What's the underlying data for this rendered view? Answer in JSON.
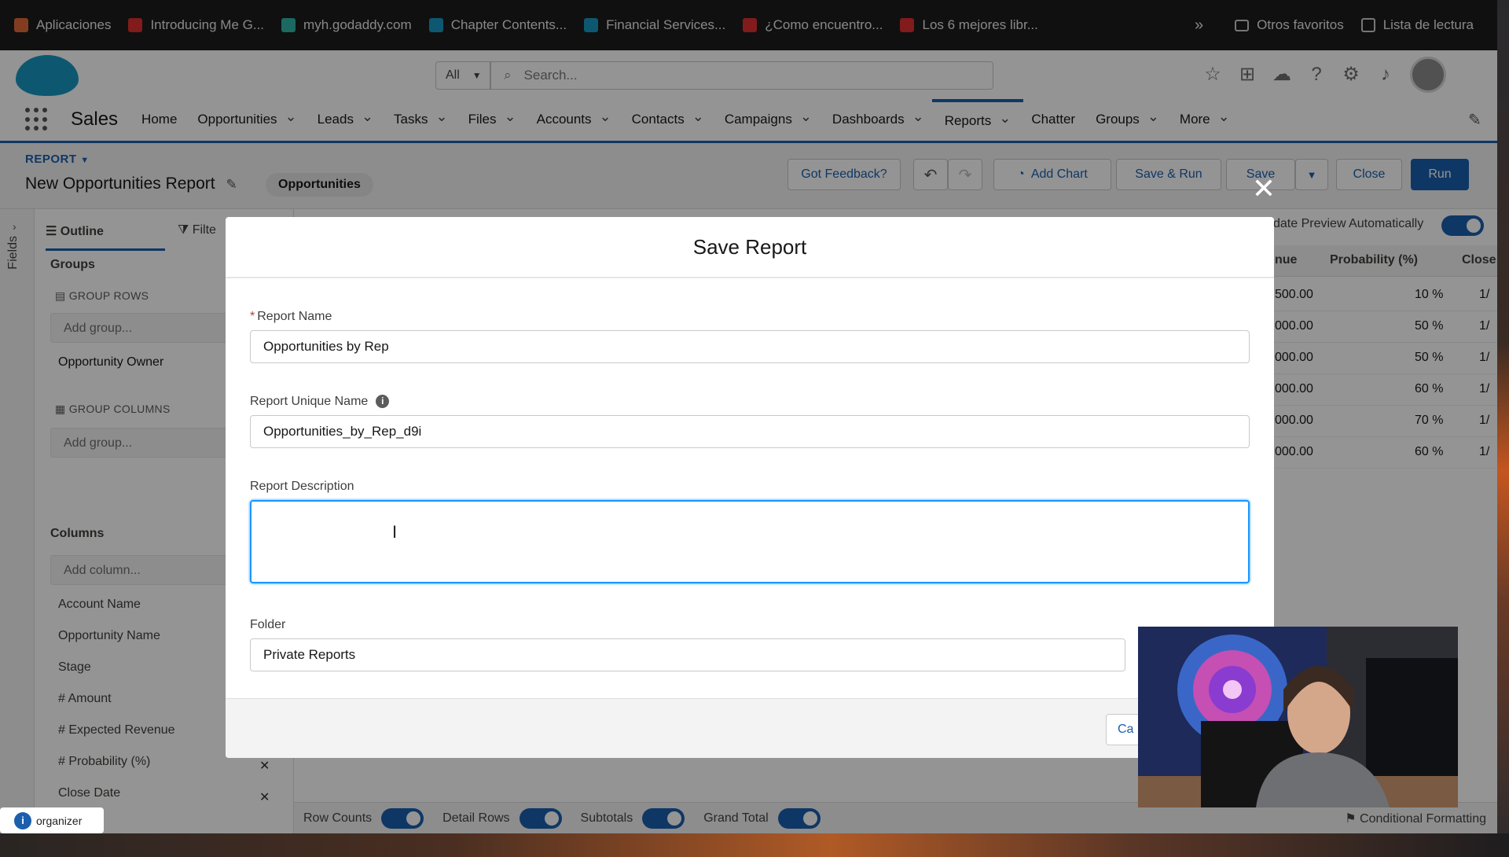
{
  "bookmarks": [
    {
      "label": "Aplicaciones",
      "color": "#e06a3a"
    },
    {
      "label": "Introducing Me G...",
      "color": "#e03030"
    },
    {
      "label": "myh.godaddy.com",
      "color": "#2fb5a5"
    },
    {
      "label": "Chapter Contents...",
      "color": "#1798c1"
    },
    {
      "label": "Financial Services...",
      "color": "#1798c1"
    },
    {
      "label": "¿Como encuentro...",
      "color": "#e03030"
    },
    {
      "label": "Los 6 mejores libr...",
      "color": "#e03030"
    }
  ],
  "bookmarks_overflow": "»",
  "bookmarks_right": [
    {
      "label": "Otros favoritos"
    },
    {
      "label": "Lista de lectura"
    }
  ],
  "search": {
    "scope": "All",
    "placeholder": "Search..."
  },
  "nav": {
    "app_name": "Sales",
    "items": [
      {
        "label": "Home",
        "chevron": false
      },
      {
        "label": "Opportunities",
        "chevron": true
      },
      {
        "label": "Leads",
        "chevron": true
      },
      {
        "label": "Tasks",
        "chevron": true
      },
      {
        "label": "Files",
        "chevron": true
      },
      {
        "label": "Accounts",
        "chevron": true
      },
      {
        "label": "Contacts",
        "chevron": true
      },
      {
        "label": "Campaigns",
        "chevron": true
      },
      {
        "label": "Dashboards",
        "chevron": true
      },
      {
        "label": "Reports",
        "chevron": true,
        "active": true
      },
      {
        "label": "Chatter",
        "chevron": false
      },
      {
        "label": "Groups",
        "chevron": true
      },
      {
        "label": "More",
        "chevron": true
      }
    ]
  },
  "report": {
    "type": "REPORT",
    "title": "New Opportunities Report",
    "badge": "Opportunities",
    "buttons": {
      "feedback": "Got Feedback?",
      "add_chart": "Add Chart",
      "save_run": "Save & Run",
      "save": "Save",
      "close": "Close",
      "run": "Run"
    },
    "update_preview": "date Preview Automatically"
  },
  "outline": {
    "tab_outline": "Outline",
    "tab_filters": "Filte",
    "groups_heading": "Groups",
    "group_rows": "GROUP ROWS",
    "add_group": "Add group...",
    "row_group_value": "Opportunity Owner",
    "group_columns": "GROUP COLUMNS",
    "columns_heading": "Columns",
    "add_column": "Add column...",
    "columns": [
      "Account Name",
      "Opportunity Name",
      "Stage",
      "# Amount",
      "# Expected Revenue",
      "# Probability (%)",
      "Close Date"
    ]
  },
  "fields_label": "Fields",
  "table": {
    "headers": [
      "nue",
      "Probability (%)",
      "Close"
    ],
    "rows": [
      [
        "500.00",
        "10 %",
        "1/"
      ],
      [
        "000.00",
        "50 %",
        "1/"
      ],
      [
        "000.00",
        "50 %",
        "1/"
      ],
      [
        "000.00",
        "60 %",
        "1/"
      ],
      [
        "000.00",
        "70 %",
        "1/"
      ],
      [
        "000.00",
        "60 %",
        "1/"
      ]
    ]
  },
  "bottom_bar": {
    "row_counts": "Row Counts",
    "detail_rows": "Detail Rows",
    "subtotals": "Subtotals",
    "grand_total": "Grand Total",
    "conditional": "Conditional Formatting"
  },
  "modal": {
    "title": "Save Report",
    "report_name_label": "Report Name",
    "report_name_value": "Opportunities by Rep",
    "unique_name_label": "Report Unique Name",
    "unique_name_value": "Opportunities_by_Rep_d9i",
    "description_label": "Report Description",
    "description_value": "",
    "folder_label": "Folder",
    "folder_value": "Private Reports",
    "cancel": "Ca"
  },
  "organizer": "organizer",
  "colors": {
    "brand": "#1b5fae",
    "accent": "#1b96ff",
    "required": "#c23934"
  }
}
